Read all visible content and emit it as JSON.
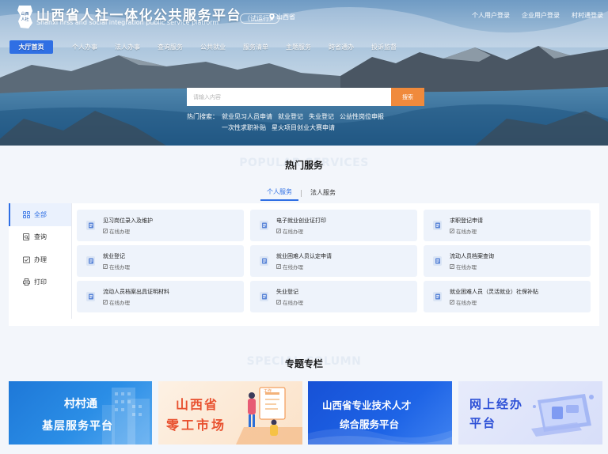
{
  "header": {
    "site_title": "山西省人社一体化公共服务平台",
    "site_subtitle": "Shanxi hrss and social integration public service platform",
    "trial_badge": "（试运行）",
    "region": "山西省",
    "top_links": [
      "个人用户登录",
      "企业用户登录",
      "村村通登录"
    ]
  },
  "nav": {
    "items": [
      "大厅首页",
      "个人办事",
      "法人办事",
      "查询服务",
      "公共就业",
      "服务清单",
      "主题服务",
      "跨省通办",
      "投诉监督"
    ],
    "active_index": 0
  },
  "search": {
    "placeholder": "请输入内容",
    "button": "搜索",
    "hot_label": "热门搜索：",
    "hot_keywords": [
      "就业见习人员申请",
      "就业登记",
      "失业登记",
      "公益性岗位申报",
      "一次性求职补贴",
      "星火项目创业大赛申请"
    ]
  },
  "popular": {
    "bg_text": "POPULAR SERVICES",
    "title": "热门服务",
    "tabs": [
      "个人服务",
      "法人服务"
    ],
    "active_tab": 0,
    "side_menu": [
      {
        "label": "全部",
        "icon": "grid-icon"
      },
      {
        "label": "查询",
        "icon": "search-doc-icon"
      },
      {
        "label": "办理",
        "icon": "handle-icon"
      },
      {
        "label": "打印",
        "icon": "printer-icon"
      }
    ],
    "cards": [
      {
        "title": "见习岗位录入及维护",
        "sub": "在线办理"
      },
      {
        "title": "电子就业创业证打印",
        "sub": "在线办理"
      },
      {
        "title": "求职登记申请",
        "sub": "在线办理"
      },
      {
        "title": "就业登记",
        "sub": "在线办理"
      },
      {
        "title": "就业困难人员认定申请",
        "sub": "在线办理"
      },
      {
        "title": "流动人员档案查询",
        "sub": "在线办理"
      },
      {
        "title": "流动人员档案出具证明材料",
        "sub": "在线办理"
      },
      {
        "title": "失业登记",
        "sub": "在线办理"
      },
      {
        "title": "就业困难人员（灵活就业）社保补贴",
        "sub": "在线办理"
      }
    ]
  },
  "special": {
    "bg_text": "SPECIAL COLUMN",
    "title": "专题专栏",
    "banners": [
      {
        "line1": "村村通",
        "line2": "基层服务平台"
      },
      {
        "line1": "山西省",
        "line2": "零工市场",
        "tag": "工作"
      },
      {
        "line1": "山西省专业技术人才",
        "line2": "综合服务平台"
      },
      {
        "line1": "网上经办",
        "line2": "平台"
      }
    ]
  },
  "colors": {
    "primary": "#2f6fe4",
    "accent": "#f08a3c"
  }
}
